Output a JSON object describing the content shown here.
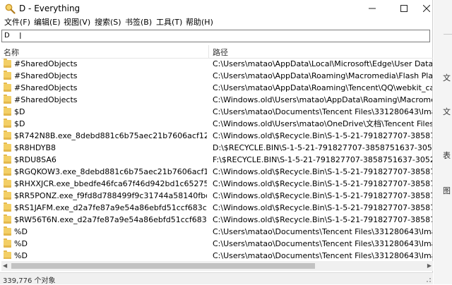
{
  "window": {
    "title": "D - Everything",
    "minimize_glyph": "—",
    "maximize_glyph": "☐",
    "close_glyph": "✕"
  },
  "menu": [
    "文件(F)",
    "编辑(E)",
    "视图(V)",
    "搜索(S)",
    "书签(B)",
    "工具(T)",
    "帮助(H)"
  ],
  "search": {
    "value": "D"
  },
  "columns": {
    "name": "名称",
    "path": "路径"
  },
  "rows": [
    {
      "name": "#SharedObjects",
      "path": "C:\\Users\\matao\\AppData\\Local\\Microsoft\\Edge\\User Data\\Default"
    },
    {
      "name": "#SharedObjects",
      "path": "C:\\Users\\matao\\AppData\\Roaming\\Macromedia\\Flash Player"
    },
    {
      "name": "#SharedObjects",
      "path": "C:\\Users\\matao\\AppData\\Roaming\\Tencent\\QQ\\webkit_cache\\331"
    },
    {
      "name": "#SharedObjects",
      "path": "C:\\Windows.old\\Users\\matao\\AppData\\Roaming\\Macromedia\\Flas"
    },
    {
      "name": "$D",
      "path": "C:\\Users\\matao\\Documents\\Tencent Files\\331280643\\Image\\Group"
    },
    {
      "name": "$D",
      "path": "C:\\Windows.old\\Users\\matao\\OneDrive\\文档\\Tencent Files\\33128064"
    },
    {
      "name": "$R742N8B.exe_8debd881c6b75aec21b7606acf12f576e30...",
      "path": "C:\\Windows.old\\$Recycle.Bin\\S-1-5-21-791827707-3858751637-305"
    },
    {
      "name": "$R8HDYB8",
      "path": "D:\\$RECYCLE.BIN\\S-1-5-21-791827707-3858751637-3052000154-10"
    },
    {
      "name": "$RDU8SA6",
      "path": "F:\\$RECYCLE.BIN\\S-1-5-21-791827707-3858751637-3052000154-10"
    },
    {
      "name": "$RGQKOW3.exe_8debd881c6b75aec21b7606acf12f576e3...",
      "path": "C:\\Windows.old\\$Recycle.Bin\\S-1-5-21-791827707-3858751637-305"
    },
    {
      "name": "$RHXXJCR.exe_bbedfe46fca67f46d942bd1c65275337b97...",
      "path": "C:\\Windows.old\\$Recycle.Bin\\S-1-5-21-791827707-3858751637-305"
    },
    {
      "name": "$RR5PONZ.exe_f9fd8d788499f9c31744a58140fbd47d67e...",
      "path": "C:\\Windows.old\\$Recycle.Bin\\S-1-5-21-791827707-3858751637-305"
    },
    {
      "name": "$RS1JAFM.exe_d2a7fe87a9e54a86ebfd51ccf683cc575b6...",
      "path": "C:\\Windows.old\\$Recycle.Bin\\S-1-5-21-791827707-3858751637-305"
    },
    {
      "name": "$RW56T6N.exe_d2a7fe87a9e54a86ebfd51ccf683cc575b6...",
      "path": "C:\\Windows.old\\$Recycle.Bin\\S-1-5-21-791827707-3858751637-305"
    },
    {
      "name": "%D",
      "path": "C:\\Users\\matao\\Documents\\Tencent Files\\331280643\\Image\\Group"
    },
    {
      "name": "%D",
      "path": "C:\\Users\\matao\\Documents\\Tencent Files\\331280643\\Image\\Group"
    },
    {
      "name": "%D",
      "path": "C:\\Users\\matao\\Documents\\Tencent Files\\331280643\\Image\\Group"
    }
  ],
  "status": {
    "text": "339,776 个对象"
  },
  "side": [
    "文",
    "文",
    "表",
    "图"
  ],
  "colors": {
    "folder": "#f3cf66",
    "status_bg": "#f0f0f0"
  },
  "icons": {
    "app": "magnifier-icon",
    "folder": "folder-icon"
  }
}
